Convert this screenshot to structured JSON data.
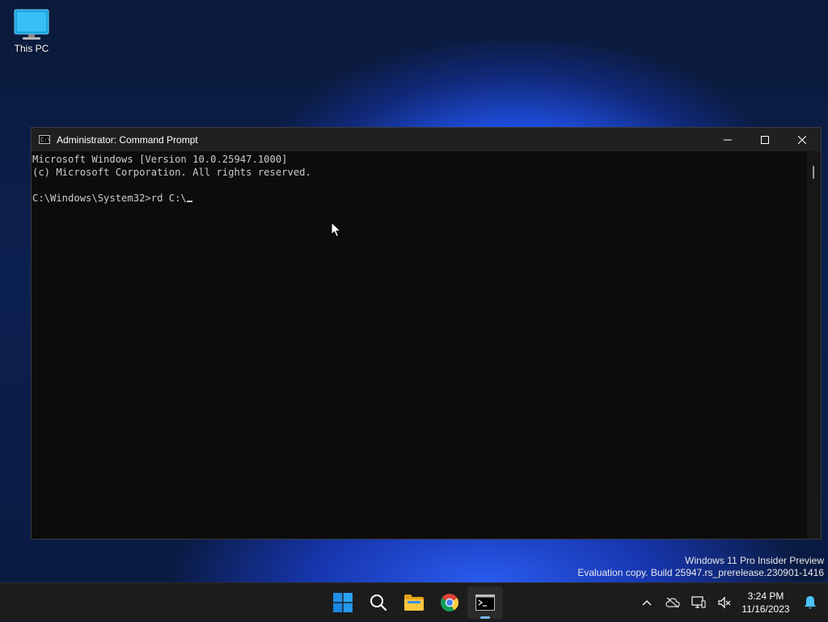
{
  "desktop": {
    "icons": [
      {
        "label": "This PC",
        "icon": "monitor-icon"
      }
    ]
  },
  "window": {
    "title": "Administrator: Command Prompt",
    "controls": {
      "minimize": "minimize-icon",
      "maximize": "maximize-icon",
      "close": "close-icon"
    },
    "console_lines": [
      "Microsoft Windows [Version 10.0.25947.1000]",
      "(c) Microsoft Corporation. All rights reserved.",
      "",
      "C:\\Windows\\System32>rd C:\\"
    ]
  },
  "watermark": {
    "line1": "Windows 11 Pro Insider Preview",
    "line2": "Evaluation copy. Build 25947.rs_prerelease.230901-1416"
  },
  "taskbar": {
    "apps": [
      {
        "name": "start",
        "icon": "windows-logo-icon"
      },
      {
        "name": "search",
        "icon": "search-icon"
      },
      {
        "name": "file-explorer",
        "icon": "folder-icon"
      },
      {
        "name": "chrome",
        "icon": "chrome-icon"
      },
      {
        "name": "command-prompt",
        "icon": "terminal-icon",
        "active": true
      }
    ],
    "tray": {
      "icons": [
        "chevron-up-icon",
        "cloud-off-icon",
        "network-icon",
        "volume-muted-icon"
      ],
      "time": "3:24 PM",
      "date": "11/16/2023",
      "notification_icon": "bell-icon"
    }
  },
  "colors": {
    "console_bg": "#0c0c0c",
    "console_text": "#cccccc",
    "titlebar_bg": "#202020",
    "taskbar_bg": "#1c1c1c",
    "active_indicator": "#76b9ed"
  }
}
